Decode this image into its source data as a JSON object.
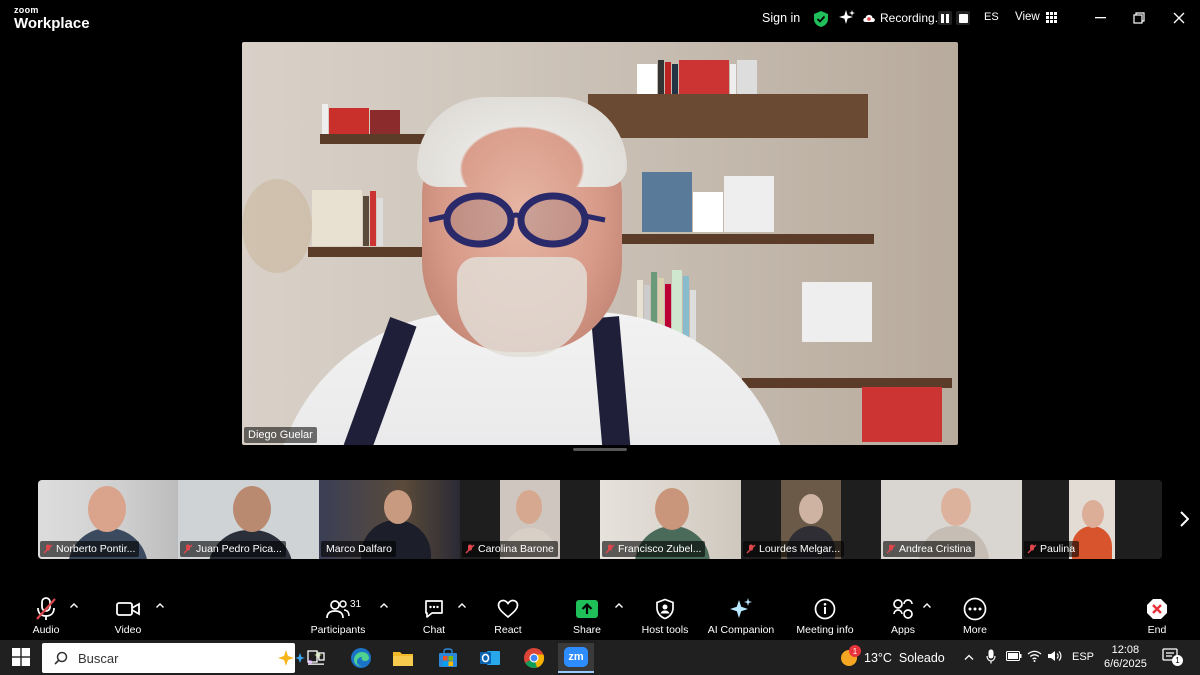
{
  "app": {
    "logo_line1": "zoom",
    "logo_line2": "Workplace"
  },
  "titlebar": {
    "signin": "Sign in",
    "recording": "Recording...",
    "language": "ES",
    "view": "View"
  },
  "main_video": {
    "name": "Diego Guelar"
  },
  "gallery": [
    {
      "name": "Norberto Pontir..."
    },
    {
      "name": "Juan Pedro Pica..."
    },
    {
      "name": "Marco Dalfaro"
    },
    {
      "name": "Carolina Barone"
    },
    {
      "name": "Francisco Zubel..."
    },
    {
      "name": "Lourdes Melgar..."
    },
    {
      "name": "Andrea Cristina"
    },
    {
      "name": "Paulina"
    }
  ],
  "toolbar": {
    "audio": "Audio",
    "video": "Video",
    "participants": "Participants",
    "participants_count": "31",
    "chat": "Chat",
    "react": "React",
    "share": "Share",
    "host_tools": "Host tools",
    "ai_companion": "AI Companion",
    "meeting_info": "Meeting info",
    "apps": "Apps",
    "more": "More",
    "end": "End"
  },
  "taskbar": {
    "search_placeholder": "Buscar",
    "zoom_app": "zm",
    "weather_badge": "1",
    "weather": "13°C  Soleado",
    "keyboard_lang": "ESP",
    "time": "12:08",
    "date": "6/6/2025",
    "notifications": "1"
  },
  "colors": {
    "accent_green": "#1fbf5a",
    "end_red": "#e8333c",
    "mute_red": "#e0474c",
    "taskbar": "#202020"
  }
}
